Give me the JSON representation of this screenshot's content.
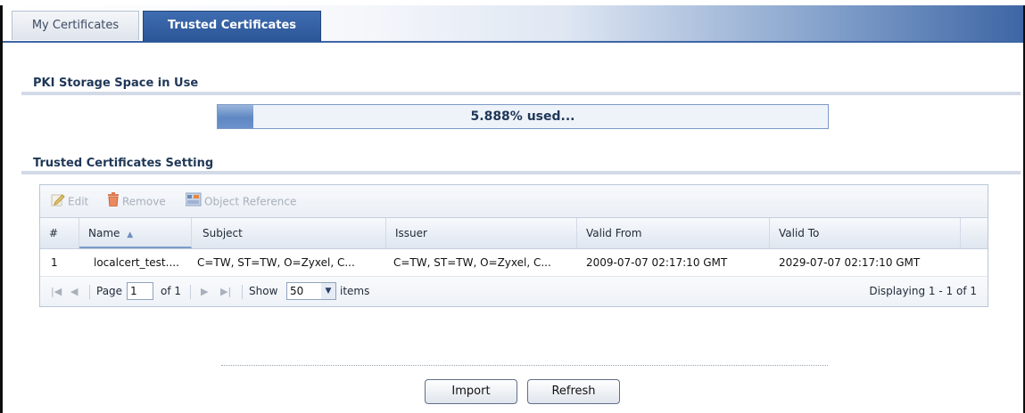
{
  "tabs": [
    {
      "label": "My Certificates",
      "active": false
    },
    {
      "label": "Trusted Certificates",
      "active": true
    }
  ],
  "storage": {
    "title": "PKI Storage Space in Use",
    "used_percent": 5.888,
    "bar_text": "5.888% used..."
  },
  "settings": {
    "title": "Trusted Certificates Setting",
    "toolbar": {
      "edit_label": "Edit",
      "remove_label": "Remove",
      "object_reference_label": "Object Reference"
    },
    "columns": {
      "index": "#",
      "name": "Name",
      "subject": "Subject",
      "issuer": "Issuer",
      "valid_from": "Valid From",
      "valid_to": "Valid To"
    },
    "rows": [
      {
        "index": "1",
        "name": "localcert_test....",
        "subject": "C=TW, ST=TW, O=Zyxel, C...",
        "issuer": "C=TW, ST=TW, O=Zyxel, C...",
        "valid_from": "2009-07-07 02:17:10 GMT",
        "valid_to": "2029-07-07 02:17:10 GMT"
      }
    ],
    "pager": {
      "page_label": "Page",
      "page_value": "1",
      "of_label": "of 1",
      "show_label": "Show",
      "show_value": "50",
      "items_label": "items",
      "displaying": "Displaying 1 - 1 of 1"
    }
  },
  "buttons": {
    "import_label": "Import",
    "refresh_label": "Refresh"
  },
  "colors": {
    "accent": "#3e66a5",
    "progress": "#5f87c3"
  }
}
